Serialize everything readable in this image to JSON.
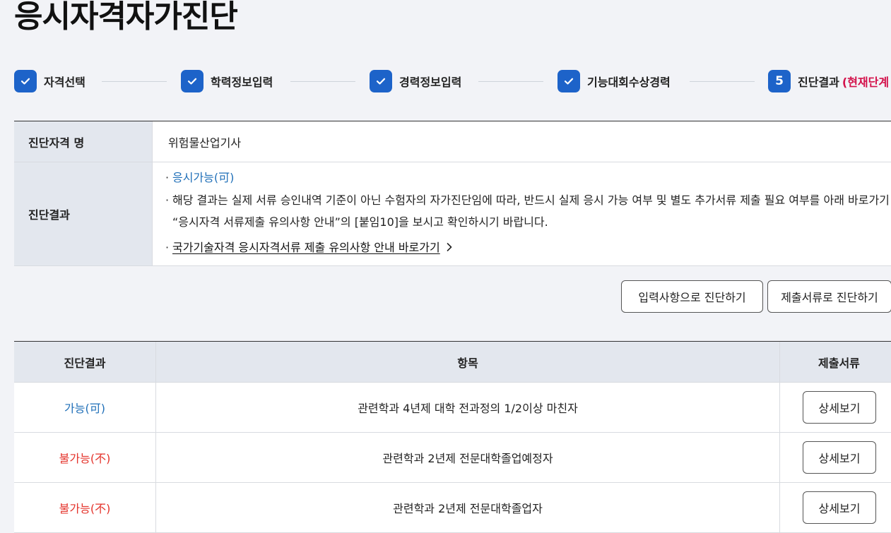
{
  "page": {
    "title": "응시자격자가진단"
  },
  "steps": [
    {
      "label": "자격선택",
      "state": "done",
      "icon": "check-icon"
    },
    {
      "label": "학력정보입력",
      "state": "done",
      "icon": "check-icon"
    },
    {
      "label": "경력정보입력",
      "state": "done",
      "icon": "check-icon"
    },
    {
      "label": "기능대회수상경력",
      "state": "done",
      "icon": "check-icon"
    },
    {
      "label": "진단결과",
      "state": "current",
      "number": "5",
      "current_tag": "(현재단계"
    }
  ],
  "summary": {
    "qualification_label": "진단자격 명",
    "qualification_value": "위험물산업기사",
    "result_label": "진단결과",
    "result_status": "응시가능(可)",
    "notice": "해당 결과는 실제 서류 승인내역 기준이 아닌 수험자의 자가진단임에 따라, 반드시 실제 응시 가능 여부 및 별도 추가서류 제출 필요 여부를 아래 바로가기 “응시자격 서류제출 유의사항 안내”의 [붙임10]을 보시고 확인하시기 바랍니다.",
    "link_text": "국가기술자격 응시자격서류 제출 유의사항 안내 바로가기"
  },
  "actions": {
    "diagnose_by_input": "입력사항으로 진단하기",
    "diagnose_by_documents": "제출서류로 진단하기"
  },
  "list": {
    "headers": {
      "result": "진단결과",
      "item": "항목",
      "documents": "제출서류"
    },
    "rows": [
      {
        "result": "가능(可)",
        "status": "possible",
        "item": "관련학과 4년제 대학 전과정의 1/2이상 마친자",
        "action": "상세보기"
      },
      {
        "result": "불가능(不)",
        "status": "impossible",
        "item": "관련학과 2년제 전문대학졸업예정자",
        "action": "상세보기"
      },
      {
        "result": "불가능(不)",
        "status": "impossible",
        "item": "관련학과 2년제 전문대학졸업자",
        "action": "상세보기"
      }
    ]
  },
  "colors": {
    "accent": "#1d63c9",
    "current": "#d3104a",
    "possible": "#1f6fb8",
    "impossible": "#e4322a"
  }
}
